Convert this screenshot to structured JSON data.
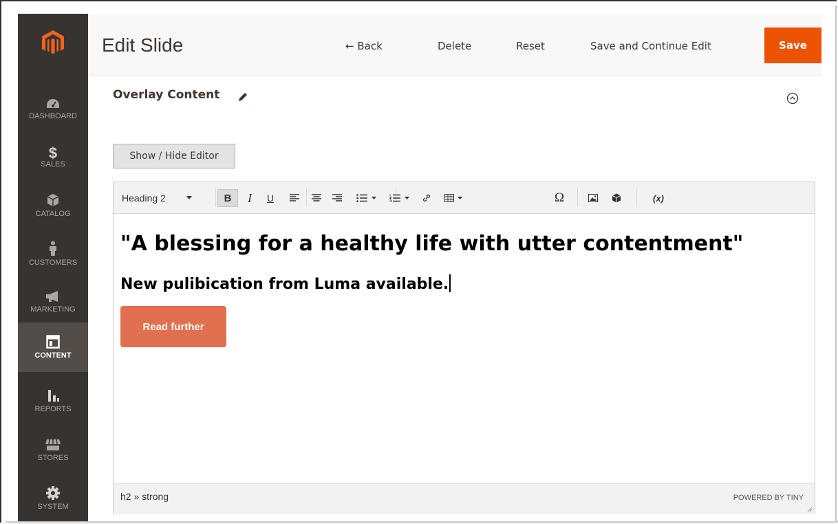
{
  "colors": {
    "sidebar_bg": "#373330",
    "sidebar_active_bg": "#524d49",
    "accent_orange": "#eb5202",
    "logo_orange": "#f26322",
    "button_salmon": "#e07050"
  },
  "sidebar": {
    "items": [
      {
        "label": "DASHBOARD",
        "icon": "dashboard-icon"
      },
      {
        "label": "SALES",
        "icon": "dollar-icon"
      },
      {
        "label": "CATALOG",
        "icon": "cube-icon"
      },
      {
        "label": "CUSTOMERS",
        "icon": "person-icon"
      },
      {
        "label": "MARKETING",
        "icon": "megaphone-icon"
      },
      {
        "label": "CONTENT",
        "icon": "layout-icon",
        "active": true
      },
      {
        "label": "REPORTS",
        "icon": "bar-chart-icon"
      },
      {
        "label": "STORES",
        "icon": "store-icon"
      },
      {
        "label": "SYSTEM",
        "icon": "gear-icon"
      }
    ]
  },
  "header": {
    "title": "Edit Slide",
    "back_label": "← Back",
    "delete_label": "Delete",
    "reset_label": "Reset",
    "save_continue_label": "Save and Continue Edit",
    "save_label": "Save"
  },
  "section": {
    "title": "Overlay Content",
    "toggle_editor_label": "Show / Hide Editor"
  },
  "editor": {
    "block_format": "Heading 2",
    "toolbar_icons": [
      "bold-icon",
      "italic-icon",
      "underline-icon",
      "align-left-icon",
      "align-center-icon",
      "align-right-icon",
      "bullet-list-icon",
      "numbered-list-icon",
      "link-icon",
      "table-icon",
      "omega-icon",
      "image-icon",
      "widget-icon",
      "variable-icon"
    ],
    "heading_text": "\"A blessing for a healthy life with utter contentment\"",
    "subheading_text": "New pulibication from Luma available.",
    "button_text": "Read further",
    "status_path": "h2 » strong",
    "powered_by": "POWERED BY TINY",
    "toolbar_labels": {
      "bold": "B",
      "italic": "I",
      "underline": "U",
      "omega": "Ω",
      "variable": "(x)"
    }
  }
}
